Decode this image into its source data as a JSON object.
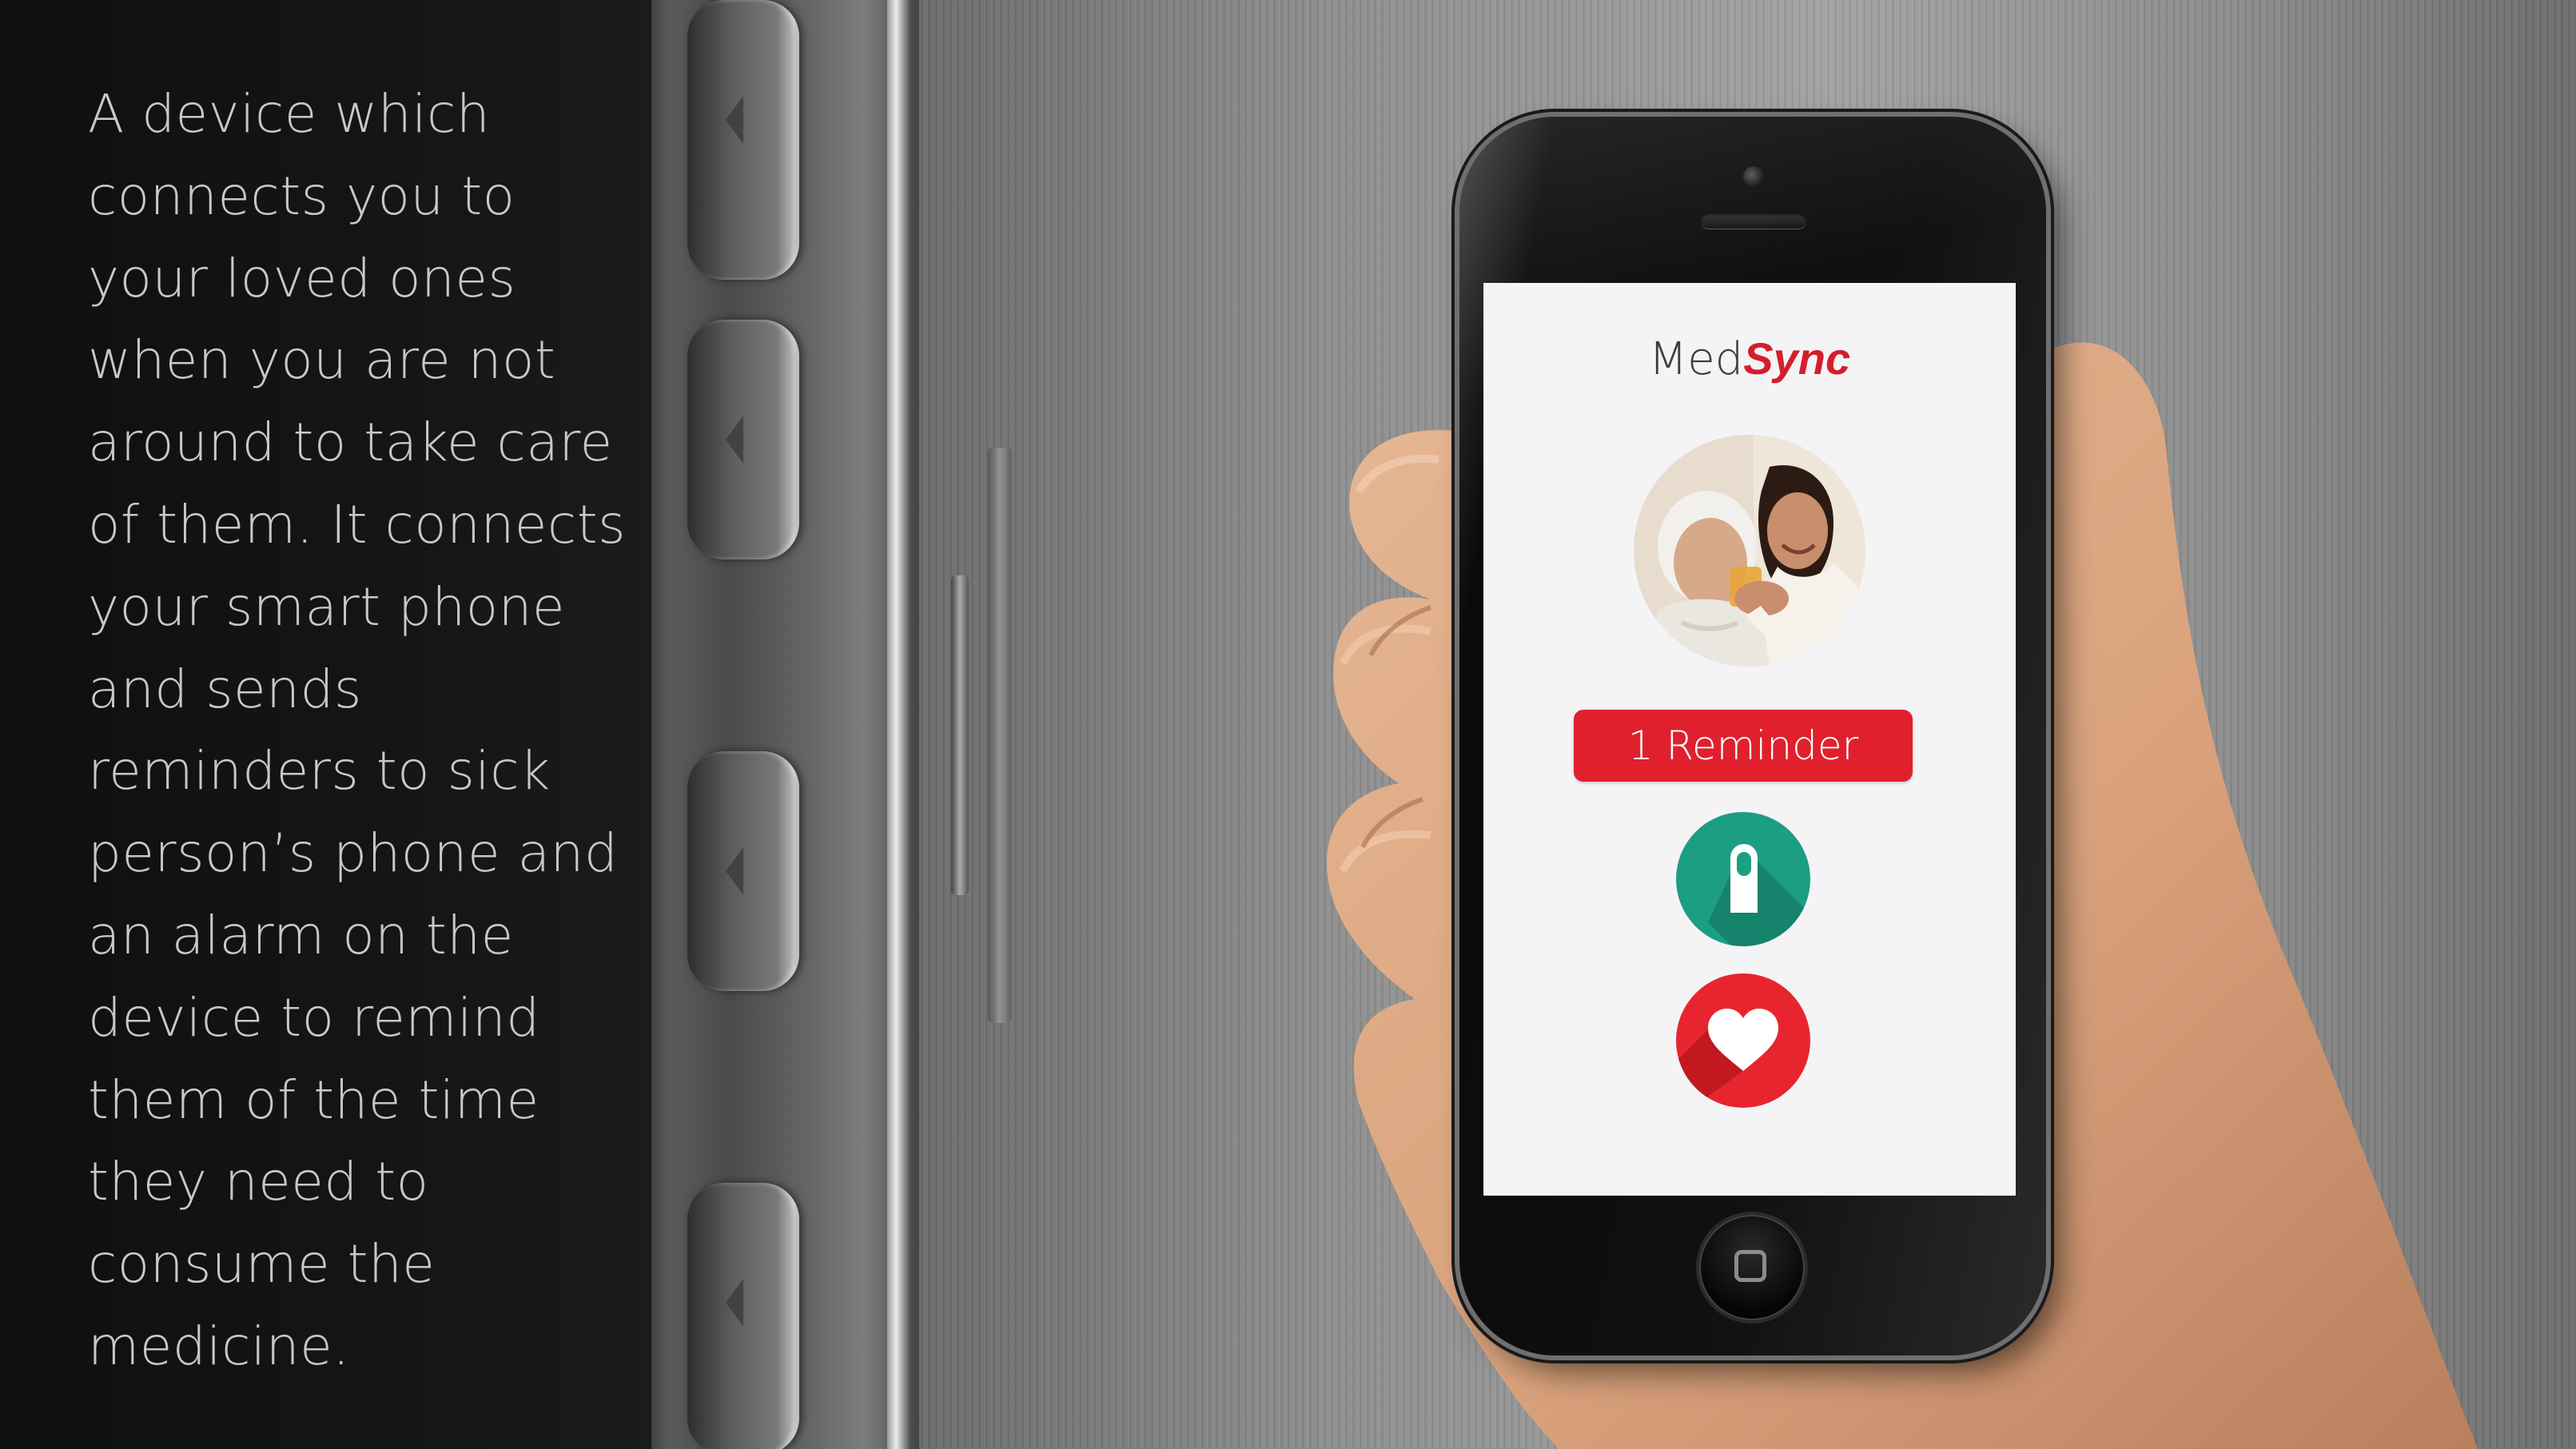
{
  "description": {
    "text": "A device which connects you to your loved ones when you are not around to take care of them. It connects your smart phone and sends reminders to sick person’s phone and an alarm on the device to remind them of the time they need to consume the medicine."
  },
  "app": {
    "brand_prefix": "Med",
    "brand_suffix": "Sync",
    "reminder_label": "1 Reminder",
    "colors": {
      "brand_red": "#d61d2c",
      "reminder_red": "#e0202d",
      "pill_green": "#1c9e82",
      "heart_red": "#e8252e"
    },
    "icons": {
      "profile": "caregiver-photo",
      "medicine": "pill-icon",
      "health": "heart-icon",
      "home": "home-button"
    }
  }
}
